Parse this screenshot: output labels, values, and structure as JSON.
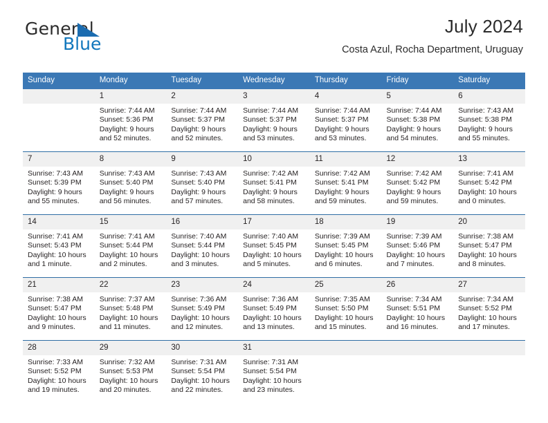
{
  "brand": {
    "name_top": "General",
    "name_bottom": "Blue",
    "accent_color": "#1076bc",
    "triangle_color": "#1b6cb0"
  },
  "header": {
    "title": "July 2024",
    "subtitle": "Costa Azul, Rocha Department, Uruguay"
  },
  "theme": {
    "header_bg": "#3b78b5",
    "row_divider": "#2e6da4",
    "daynum_bg": "#f0f0f0",
    "text": "#231f20"
  },
  "calendar": {
    "weekday_headers": [
      "Sunday",
      "Monday",
      "Tuesday",
      "Wednesday",
      "Thursday",
      "Friday",
      "Saturday"
    ],
    "weeks": [
      [
        {
          "day": "",
          "sunrise": "",
          "sunset": "",
          "daylight_line1": "",
          "daylight_line2": ""
        },
        {
          "day": "1",
          "sunrise": "Sunrise: 7:44 AM",
          "sunset": "Sunset: 5:36 PM",
          "daylight_line1": "Daylight: 9 hours",
          "daylight_line2": "and 52 minutes."
        },
        {
          "day": "2",
          "sunrise": "Sunrise: 7:44 AM",
          "sunset": "Sunset: 5:37 PM",
          "daylight_line1": "Daylight: 9 hours",
          "daylight_line2": "and 52 minutes."
        },
        {
          "day": "3",
          "sunrise": "Sunrise: 7:44 AM",
          "sunset": "Sunset: 5:37 PM",
          "daylight_line1": "Daylight: 9 hours",
          "daylight_line2": "and 53 minutes."
        },
        {
          "day": "4",
          "sunrise": "Sunrise: 7:44 AM",
          "sunset": "Sunset: 5:37 PM",
          "daylight_line1": "Daylight: 9 hours",
          "daylight_line2": "and 53 minutes."
        },
        {
          "day": "5",
          "sunrise": "Sunrise: 7:44 AM",
          "sunset": "Sunset: 5:38 PM",
          "daylight_line1": "Daylight: 9 hours",
          "daylight_line2": "and 54 minutes."
        },
        {
          "day": "6",
          "sunrise": "Sunrise: 7:43 AM",
          "sunset": "Sunset: 5:38 PM",
          "daylight_line1": "Daylight: 9 hours",
          "daylight_line2": "and 55 minutes."
        }
      ],
      [
        {
          "day": "7",
          "sunrise": "Sunrise: 7:43 AM",
          "sunset": "Sunset: 5:39 PM",
          "daylight_line1": "Daylight: 9 hours",
          "daylight_line2": "and 55 minutes."
        },
        {
          "day": "8",
          "sunrise": "Sunrise: 7:43 AM",
          "sunset": "Sunset: 5:40 PM",
          "daylight_line1": "Daylight: 9 hours",
          "daylight_line2": "and 56 minutes."
        },
        {
          "day": "9",
          "sunrise": "Sunrise: 7:43 AM",
          "sunset": "Sunset: 5:40 PM",
          "daylight_line1": "Daylight: 9 hours",
          "daylight_line2": "and 57 minutes."
        },
        {
          "day": "10",
          "sunrise": "Sunrise: 7:42 AM",
          "sunset": "Sunset: 5:41 PM",
          "daylight_line1": "Daylight: 9 hours",
          "daylight_line2": "and 58 minutes."
        },
        {
          "day": "11",
          "sunrise": "Sunrise: 7:42 AM",
          "sunset": "Sunset: 5:41 PM",
          "daylight_line1": "Daylight: 9 hours",
          "daylight_line2": "and 59 minutes."
        },
        {
          "day": "12",
          "sunrise": "Sunrise: 7:42 AM",
          "sunset": "Sunset: 5:42 PM",
          "daylight_line1": "Daylight: 9 hours",
          "daylight_line2": "and 59 minutes."
        },
        {
          "day": "13",
          "sunrise": "Sunrise: 7:41 AM",
          "sunset": "Sunset: 5:42 PM",
          "daylight_line1": "Daylight: 10 hours",
          "daylight_line2": "and 0 minutes."
        }
      ],
      [
        {
          "day": "14",
          "sunrise": "Sunrise: 7:41 AM",
          "sunset": "Sunset: 5:43 PM",
          "daylight_line1": "Daylight: 10 hours",
          "daylight_line2": "and 1 minute."
        },
        {
          "day": "15",
          "sunrise": "Sunrise: 7:41 AM",
          "sunset": "Sunset: 5:44 PM",
          "daylight_line1": "Daylight: 10 hours",
          "daylight_line2": "and 2 minutes."
        },
        {
          "day": "16",
          "sunrise": "Sunrise: 7:40 AM",
          "sunset": "Sunset: 5:44 PM",
          "daylight_line1": "Daylight: 10 hours",
          "daylight_line2": "and 3 minutes."
        },
        {
          "day": "17",
          "sunrise": "Sunrise: 7:40 AM",
          "sunset": "Sunset: 5:45 PM",
          "daylight_line1": "Daylight: 10 hours",
          "daylight_line2": "and 5 minutes."
        },
        {
          "day": "18",
          "sunrise": "Sunrise: 7:39 AM",
          "sunset": "Sunset: 5:45 PM",
          "daylight_line1": "Daylight: 10 hours",
          "daylight_line2": "and 6 minutes."
        },
        {
          "day": "19",
          "sunrise": "Sunrise: 7:39 AM",
          "sunset": "Sunset: 5:46 PM",
          "daylight_line1": "Daylight: 10 hours",
          "daylight_line2": "and 7 minutes."
        },
        {
          "day": "20",
          "sunrise": "Sunrise: 7:38 AM",
          "sunset": "Sunset: 5:47 PM",
          "daylight_line1": "Daylight: 10 hours",
          "daylight_line2": "and 8 minutes."
        }
      ],
      [
        {
          "day": "21",
          "sunrise": "Sunrise: 7:38 AM",
          "sunset": "Sunset: 5:47 PM",
          "daylight_line1": "Daylight: 10 hours",
          "daylight_line2": "and 9 minutes."
        },
        {
          "day": "22",
          "sunrise": "Sunrise: 7:37 AM",
          "sunset": "Sunset: 5:48 PM",
          "daylight_line1": "Daylight: 10 hours",
          "daylight_line2": "and 11 minutes."
        },
        {
          "day": "23",
          "sunrise": "Sunrise: 7:36 AM",
          "sunset": "Sunset: 5:49 PM",
          "daylight_line1": "Daylight: 10 hours",
          "daylight_line2": "and 12 minutes."
        },
        {
          "day": "24",
          "sunrise": "Sunrise: 7:36 AM",
          "sunset": "Sunset: 5:49 PM",
          "daylight_line1": "Daylight: 10 hours",
          "daylight_line2": "and 13 minutes."
        },
        {
          "day": "25",
          "sunrise": "Sunrise: 7:35 AM",
          "sunset": "Sunset: 5:50 PM",
          "daylight_line1": "Daylight: 10 hours",
          "daylight_line2": "and 15 minutes."
        },
        {
          "day": "26",
          "sunrise": "Sunrise: 7:34 AM",
          "sunset": "Sunset: 5:51 PM",
          "daylight_line1": "Daylight: 10 hours",
          "daylight_line2": "and 16 minutes."
        },
        {
          "day": "27",
          "sunrise": "Sunrise: 7:34 AM",
          "sunset": "Sunset: 5:52 PM",
          "daylight_line1": "Daylight: 10 hours",
          "daylight_line2": "and 17 minutes."
        }
      ],
      [
        {
          "day": "28",
          "sunrise": "Sunrise: 7:33 AM",
          "sunset": "Sunset: 5:52 PM",
          "daylight_line1": "Daylight: 10 hours",
          "daylight_line2": "and 19 minutes."
        },
        {
          "day": "29",
          "sunrise": "Sunrise: 7:32 AM",
          "sunset": "Sunset: 5:53 PM",
          "daylight_line1": "Daylight: 10 hours",
          "daylight_line2": "and 20 minutes."
        },
        {
          "day": "30",
          "sunrise": "Sunrise: 7:31 AM",
          "sunset": "Sunset: 5:54 PM",
          "daylight_line1": "Daylight: 10 hours",
          "daylight_line2": "and 22 minutes."
        },
        {
          "day": "31",
          "sunrise": "Sunrise: 7:31 AM",
          "sunset": "Sunset: 5:54 PM",
          "daylight_line1": "Daylight: 10 hours",
          "daylight_line2": "and 23 minutes."
        },
        {
          "day": "",
          "sunrise": "",
          "sunset": "",
          "daylight_line1": "",
          "daylight_line2": ""
        },
        {
          "day": "",
          "sunrise": "",
          "sunset": "",
          "daylight_line1": "",
          "daylight_line2": ""
        },
        {
          "day": "",
          "sunrise": "",
          "sunset": "",
          "daylight_line1": "",
          "daylight_line2": ""
        }
      ]
    ]
  }
}
